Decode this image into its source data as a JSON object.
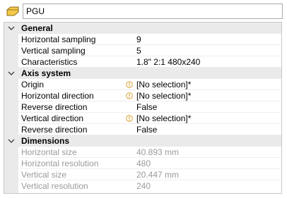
{
  "header": {
    "name_value": "PGU",
    "icon": "folder-tag-icon"
  },
  "colors": {
    "category_bg": "#eaeaea",
    "disabled_text": "#9a9a9a",
    "warning_icon": "#d9a032"
  },
  "sections": [
    {
      "title": "General",
      "rows": [
        {
          "label": "Horizontal sampling",
          "value": "9"
        },
        {
          "label": "Vertical sampling",
          "value": "5"
        },
        {
          "label": "Characteristics",
          "value": "1.8\" 2:1  480x240"
        }
      ]
    },
    {
      "title": "Axis system",
      "rows": [
        {
          "label": "Origin",
          "value": "[No selection]*",
          "warning": true
        },
        {
          "label": "Horizontal direction",
          "value": "[No selection]*",
          "warning": true
        },
        {
          "label": "Reverse direction",
          "value": "False"
        },
        {
          "label": "Vertical direction",
          "value": "[No selection]*",
          "warning": true
        },
        {
          "label": "Reverse direction",
          "value": "False"
        }
      ]
    },
    {
      "title": "Dimensions",
      "rows": [
        {
          "label": "Horizontal size",
          "value": "40.893 mm",
          "disabled": true
        },
        {
          "label": "Horizontal resolution",
          "value": "480",
          "disabled": true
        },
        {
          "label": "Vertical size",
          "value": "20.447 mm",
          "disabled": true
        },
        {
          "label": "Vertical resolution",
          "value": "240",
          "disabled": true
        }
      ]
    }
  ]
}
